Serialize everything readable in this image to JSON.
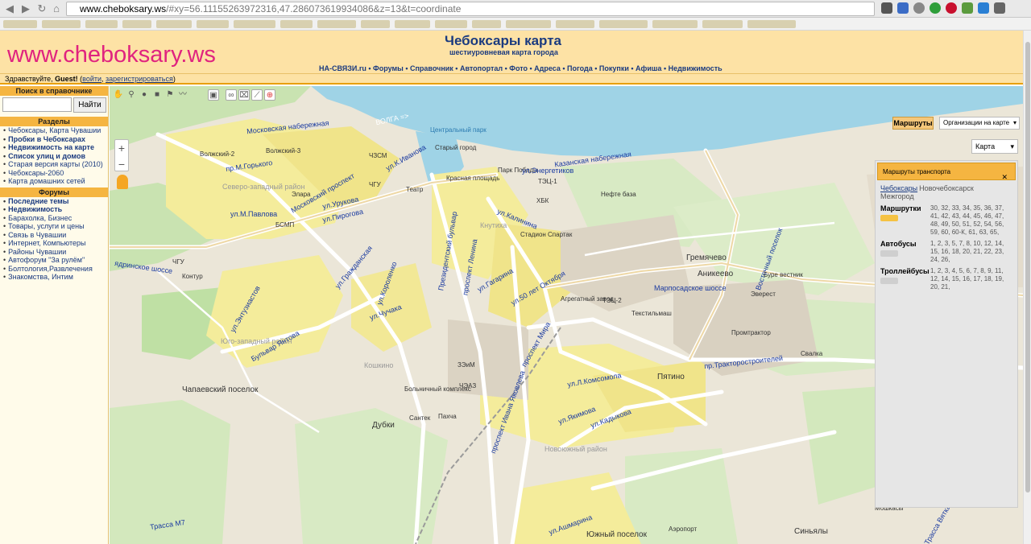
{
  "browser": {
    "url_domain": "www.cheboksary.ws",
    "url_rest": "/#xy=56.11155263972316,47.286073619934086&z=13&t=coordinate"
  },
  "header": {
    "logo": "www.cheboksary.ws",
    "title": "Чебоксары карта",
    "subtitle": "шестиуровневая карта города",
    "nav": [
      "НА-СВЯЗИ.ru",
      "Форумы",
      "Справочник",
      "Автопортал",
      "Фото",
      "Адреса",
      "Погода",
      "Покупки",
      "Афиша",
      "Недвижимость"
    ],
    "nav_separator": " • "
  },
  "greeting": {
    "text": "Здравствуйте, ",
    "user": "Guest!",
    "login": "войти",
    "register": "зарегистрироваться"
  },
  "sidebar": {
    "search_head": "Поиск в справочнике",
    "search_button": "Найти",
    "sections_head": "Разделы",
    "sections": [
      {
        "label": "Чебоксары, Карта Чувашии",
        "bold": false
      },
      {
        "label": "Пробки в Чебоксарах",
        "bold": true
      },
      {
        "label": "Недвижимость на карте",
        "bold": true
      },
      {
        "label": "Список улиц и домов",
        "bold": true
      },
      {
        "label": "Старая версия карты (2010)",
        "bold": false
      },
      {
        "label": "Чебоксары-2060",
        "bold": false
      },
      {
        "label": "Карта домашних сетей",
        "bold": false
      }
    ],
    "forums_head": "Форумы",
    "forums": [
      {
        "label": "Последние темы",
        "bold": true
      },
      {
        "label": "Недвижимость",
        "bold": true
      },
      {
        "label": "Барахолка, Бизнес",
        "bold": false
      },
      {
        "label": "Товары, услуги и цены",
        "bold": false
      },
      {
        "label": "Связь в Чувашии",
        "bold": false
      },
      {
        "label": "Интернет, Компьютеры",
        "bold": false
      },
      {
        "label": "Районы Чувашии",
        "bold": false
      },
      {
        "label": "Автофорум \"За рулём\"",
        "bold": false
      },
      {
        "label": "Болтология,Развлечения",
        "bold": false
      },
      {
        "label": "Знакомства, Интим",
        "bold": false
      }
    ]
  },
  "map": {
    "routes_button": "Маршруты",
    "org_select": "Организации на карте",
    "map_type": "Карта",
    "zoom_in": "+",
    "zoom_out": "−",
    "labels": {
      "volga": "ВОЛГА =>",
      "moskovsky_nab": "Московская набережная",
      "volzhsky2": "Волжский-2",
      "volzhsky3": "Волжский-3",
      "gorkogo": "пр.М.Горького",
      "chzsm": "ЧЗСМ",
      "ivanova": "ул.К.Иванова",
      "stary_gorod": "Старый город",
      "central_park": "Центральный парк",
      "park_pobedy": "Парк Победы",
      "kazanskaya_nab": "Казанская набережная",
      "severo_zapad": "Северо-западный район",
      "moskovsky_pr": "Московский проспект",
      "elara": "Элара",
      "chgu": "ЧГУ",
      "teatr": "Театр",
      "krasnaya_pl": "Красная площадь",
      "tec1": "ТЭЦ-1",
      "energetikov": "ул.Энергетиков",
      "pavlova": "ул.М.Павлова",
      "urukova": "ул.Урукова",
      "pirogova": "ул.Пирогова",
      "bsmp": "БСМП",
      "knutikha": "Кнутиха",
      "kalinina": "ул.Калинина",
      "hbk": "ХБК",
      "neftebaza": "Нефте база",
      "stadion_spartak": "Стадион Спартак",
      "gremyachevo": "Гремячево",
      "anikeevo": "Аникеево",
      "vostochny": "Восточный поселок",
      "burevestnik": "Буре вестник",
      "everest": "Эверест",
      "yadrinskoe": "ядринское шоссе",
      "chgu2": "ЧГУ",
      "kontur": "Контур",
      "ul_grazhdanskaya": "ул.Гражданская",
      "ul_korolenko": "ул.Короленко",
      "ul_chuchaka": "ул.Чучака",
      "prezident_bulvar": "Президентский бульвар",
      "ul_yakovleva": "ул.Яковлева",
      "pr_lenina": "проспект Ленина",
      "ul_gagarina": "ул.Гагарина",
      "ul_50_oktyabrya": "ул.50 лет Октября",
      "agregatny": "Агрегатный завод",
      "tec2": "ТЭЦ-2",
      "marposadskoe": "Марпосадское шоссе",
      "promtraktor": "Промтрактор",
      "tekstilmash": "Текстильмаш",
      "svalka": "Свалка",
      "pr_traktorostroiteley": "пр.Тракторостроителей",
      "pyatino": "Пятино",
      "yugo_zapad": "Юго-западный район",
      "chapaevsky": "Чапаевский поселок",
      "ul_entuziastov": "ул.Энтузиастов",
      "bulvar_yantova": "Бульвар Янтова",
      "kashino": "Кошкино",
      "pr_ivana_yakovleva": "проспект Ивана Яковлева",
      "pr_mira": "проспект Мира",
      "ul_komsomola": "ул.Л.Комсомола",
      "novogorodnoy": "Новоюжный район",
      "dubki": "Дубки",
      "santek": "Сантек",
      "pakhta": "Пахча",
      "yuzhny_poselok": "Южный поселок",
      "aeroport": "Аэропорт",
      "sinyaly": "Синьялы",
      "moshkasy": "Мошкасы",
      "trassa_m7": "Трасса М7",
      "ul_kadykova": "ул.Кадыкова",
      "ul_yakimova": "ул.Якимова",
      "bolnichny": "Больничный комплекс",
      "chezt": "ЧЭАЗ",
      "sezm": "ЗЭиМ",
      "novogradskaya": "ул.Ашмарина",
      "trassa_vyatka": "Трасса Вятка"
    },
    "panel": {
      "title": "Маршруты транспорта",
      "tabs": [
        "Чебоксары",
        "Новочебоксарск",
        "Межгород"
      ],
      "rows": [
        {
          "label": "Маршрутки",
          "numbers": "30, 32, 33, 34, 35, 36, 37, 41, 42, 43, 44, 45, 46, 47, 48, 49, 50, 51, 52, 54, 56, 59, 60, 60-К, 61, 63, 65,"
        },
        {
          "label": "Автобусы",
          "numbers": "1, 2, 3, 5, 7, 8, 10, 12, 14, 15, 16, 18, 20, 21, 22, 23, 24, 26,"
        },
        {
          "label": "Троллейбусы",
          "numbers": "1, 2, 3, 4, 5, 6, 7, 8, 9, 11, 12, 14, 15, 16, 17, 18, 19, 20, 21,"
        }
      ]
    }
  }
}
